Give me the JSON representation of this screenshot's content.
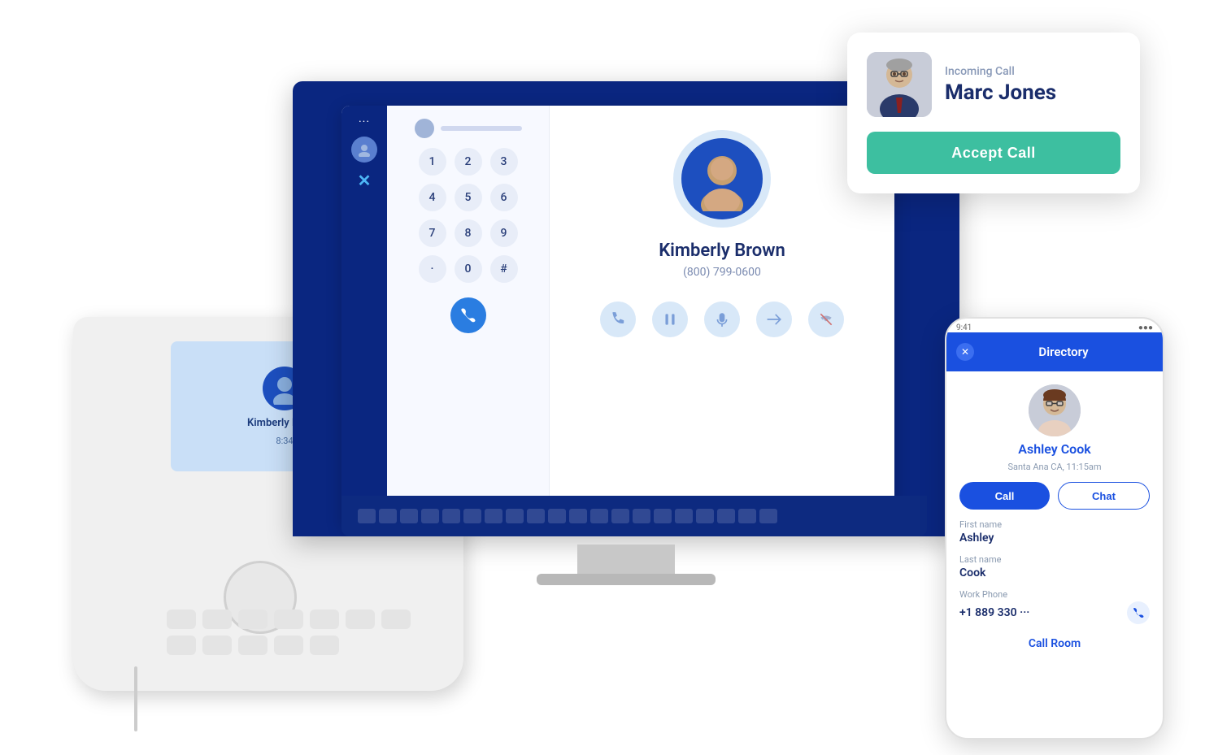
{
  "incoming_call": {
    "label": "Incoming Call",
    "caller_name": "Marc Jones",
    "accept_button": "Accept Call"
  },
  "contact_panel": {
    "name": "Kimberly Brown",
    "phone": "(800) 799-0600"
  },
  "phone_display": {
    "name": "Kimberly Brown",
    "time": "8:34"
  },
  "dialpad": {
    "keys": [
      "1",
      "2",
      "3",
      "4",
      "5",
      "6",
      "7",
      "8",
      "9",
      "·",
      "0",
      "#"
    ]
  },
  "mobile_directory": {
    "header_title": "Directory",
    "contact_name": "Ashley Cook",
    "contact_location": "Santa Ana CA, 11:15am",
    "call_button": "Call",
    "chat_button": "Chat",
    "first_name_label": "First name",
    "first_name_value": "Ashley",
    "last_name_label": "Last name",
    "last_name_value": "Cook",
    "work_phone_label": "Work Phone",
    "work_phone_value": "+1 889 330 ···",
    "call_room_link": "Call Room",
    "close_icon": "✕"
  },
  "app_sidebar": {
    "dots": "···",
    "logo": "✕"
  },
  "colors": {
    "brand_blue": "#1a50e0",
    "teal_accept": "#3dbfa0",
    "dark_navy": "#0a2680"
  }
}
